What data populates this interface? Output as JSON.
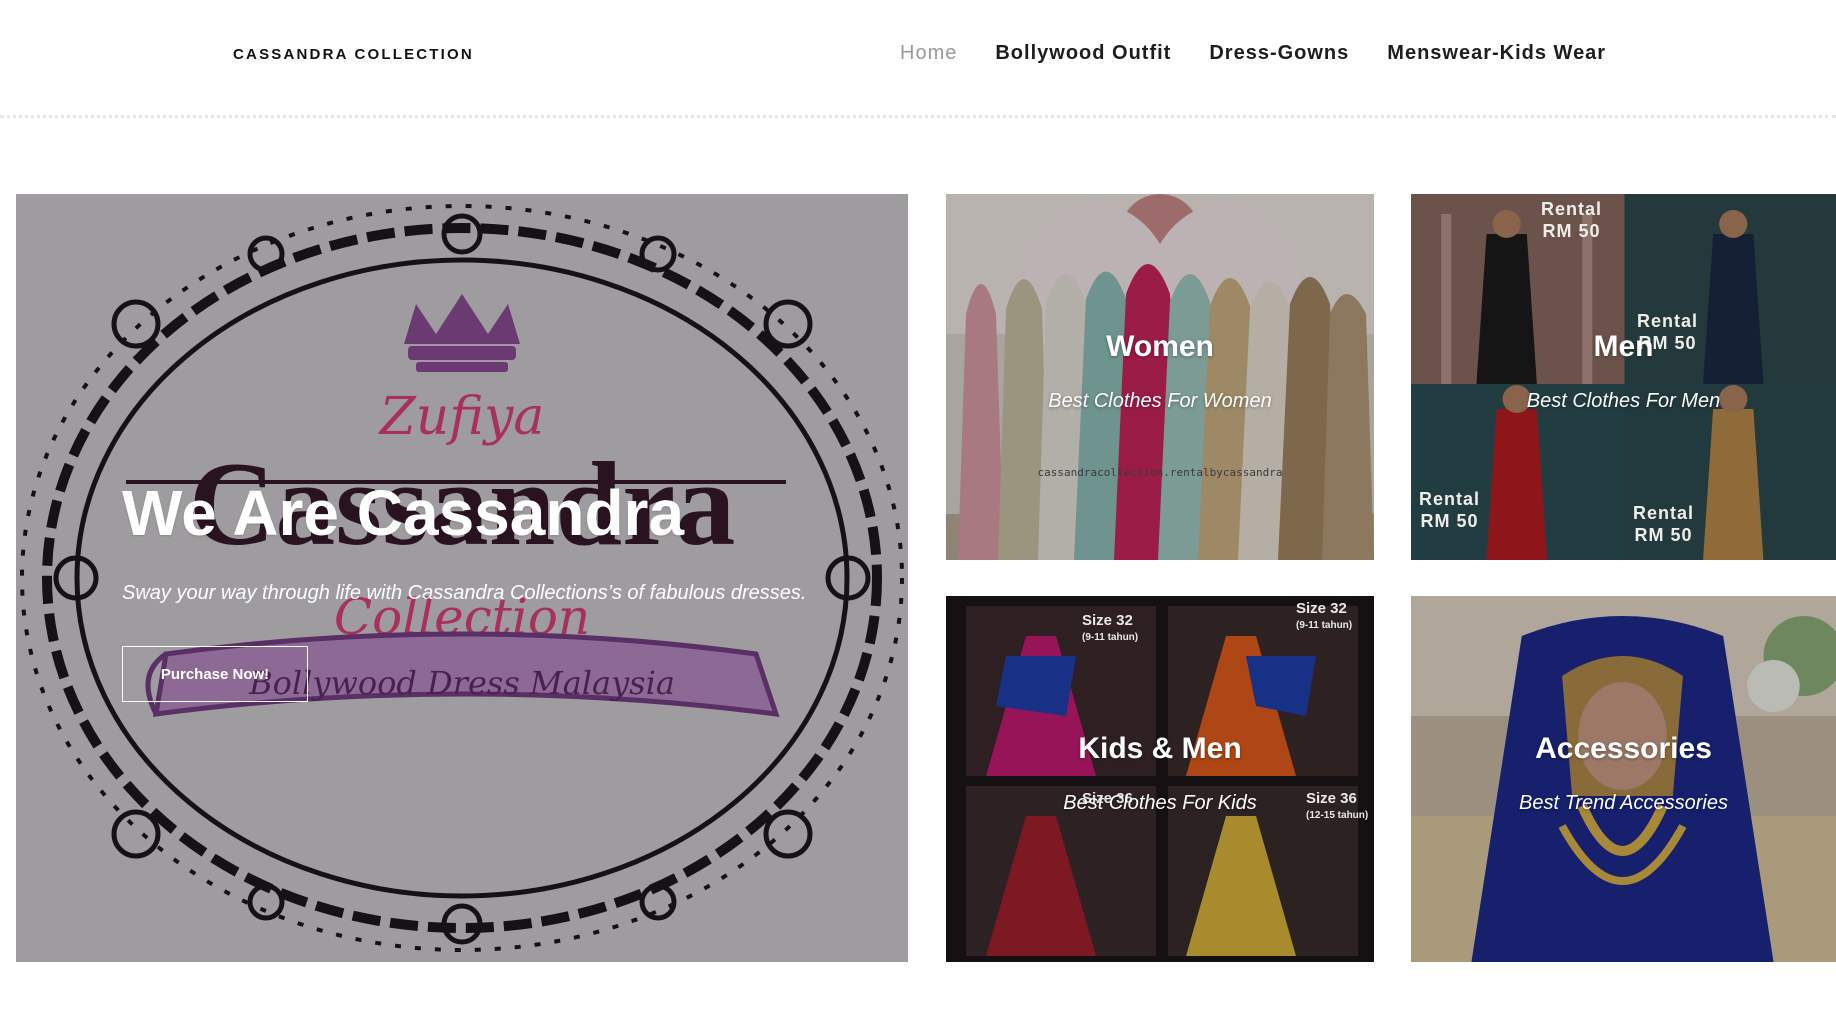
{
  "header": {
    "logo": "CASSANDRA COLLECTION",
    "nav": [
      {
        "label": "Home",
        "active": true
      },
      {
        "label": "Bollywood Outfit",
        "active": false
      },
      {
        "label": "Dress-Gowns",
        "active": false
      },
      {
        "label": "Menswear-Kids Wear",
        "active": false
      }
    ]
  },
  "hero": {
    "title": "We Are Cassandra",
    "subtitle": "Sway your way through life with Cassandra Collections’s of fabulous dresses.",
    "button": "Purchase Now!",
    "logo_art": {
      "script_top": "Zufiya",
      "brand": "Cassandra",
      "script_bottom": "Collection",
      "ribbon": "Bollywood Dress Malaysia"
    }
  },
  "tiles": [
    {
      "title": "Women",
      "subtitle": "Best Clothes For Women",
      "watermark": "cassandracollection.rentalbycassandra"
    },
    {
      "title": "Men",
      "subtitle": "Best Clothes For Men",
      "badges": [
        {
          "line1": "Rental",
          "line2": "RM 50"
        },
        {
          "line1": "Rental",
          "line2": "RM 50"
        },
        {
          "line1": "Rental",
          "line2": "RM 50"
        },
        {
          "line1": "Rental",
          "line2": "RM 50"
        }
      ]
    },
    {
      "title": "Kids & Men",
      "subtitle": "Best Clothes For Kids",
      "sizes": [
        {
          "size": "Size 32",
          "age": "(9-11 tahun)"
        },
        {
          "size": "Size 32",
          "age": "(9-11 tahun)"
        },
        {
          "size": "Size 36",
          "age": ""
        },
        {
          "size": "Size 36",
          "age": "(12-15 tahun)"
        }
      ]
    },
    {
      "title": "Accessories",
      "subtitle": "Best Trend Accessories"
    }
  ],
  "colors": {
    "hero_bg": "#9e9c9f",
    "nav_active": "#9a9a9a",
    "logo_purple": "#6b3a73",
    "logo_crimson": "#a8305f"
  }
}
